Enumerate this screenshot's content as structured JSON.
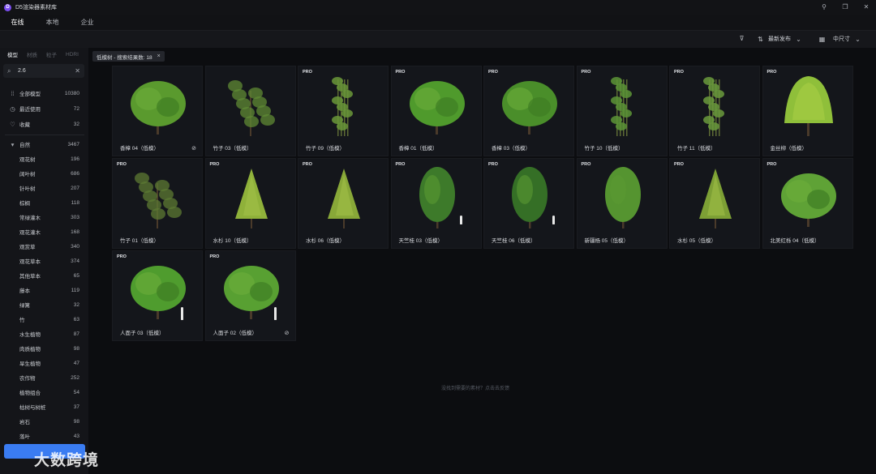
{
  "app": {
    "logo_letter": "D",
    "title": "D5渲染器素材库"
  },
  "window_buttons": [
    "pin",
    "restore",
    "close"
  ],
  "top_tabs": [
    {
      "label": "在线",
      "active": true
    },
    {
      "label": "本地",
      "active": false
    },
    {
      "label": "企业",
      "active": false
    }
  ],
  "toolbar": {
    "filter_icon": "filter-icon",
    "sort_label": "最新发布",
    "size_label": "中尺寸"
  },
  "sidebar": {
    "tabs": [
      {
        "label": "模型",
        "active": true
      },
      {
        "label": "材质",
        "active": false
      },
      {
        "label": "粒子",
        "active": false
      },
      {
        "label": "HDRI",
        "active": false
      }
    ],
    "search": {
      "value": "2.6"
    },
    "quick": [
      {
        "icon": "grid-icon",
        "label": "全部模型",
        "count": "10380"
      },
      {
        "icon": "clock-icon",
        "label": "最近使用",
        "count": "72"
      },
      {
        "icon": "heart-icon",
        "label": "收藏",
        "count": "32"
      }
    ],
    "category": {
      "label": "自然",
      "count": "3467"
    },
    "items": [
      {
        "label": "观花树",
        "count": "196"
      },
      {
        "label": "阔叶树",
        "count": "686"
      },
      {
        "label": "针叶树",
        "count": "207"
      },
      {
        "label": "棕榈",
        "count": "118"
      },
      {
        "label": "常绿灌木",
        "count": "303"
      },
      {
        "label": "观花灌木",
        "count": "168"
      },
      {
        "label": "观赏草",
        "count": "340"
      },
      {
        "label": "观花草本",
        "count": "374"
      },
      {
        "label": "其他草本",
        "count": "65"
      },
      {
        "label": "藤本",
        "count": "119"
      },
      {
        "label": "绿篱",
        "count": "32"
      },
      {
        "label": "竹",
        "count": "63"
      },
      {
        "label": "水生植物",
        "count": "87"
      },
      {
        "label": "肉质植物",
        "count": "98"
      },
      {
        "label": "旱生植物",
        "count": "47"
      },
      {
        "label": "农作物",
        "count": "252"
      },
      {
        "label": "植物组合",
        "count": "54"
      },
      {
        "label": "枯树与树桩",
        "count": "37"
      },
      {
        "label": "岩石",
        "count": "98"
      },
      {
        "label": "落叶",
        "count": "43"
      }
    ]
  },
  "chip": {
    "label": "低模树 - 搜索结果数: 18",
    "close": "×"
  },
  "cards": [
    {
      "name": "香樟 04（低模）",
      "pro": "",
      "check": true,
      "person": false,
      "shape": "round",
      "color": "#5a9a2e"
    },
    {
      "name": "竹子 03（低模）",
      "pro": "",
      "check": false,
      "person": false,
      "shape": "sparse",
      "color": "#5f8a34"
    },
    {
      "name": "竹子 09（低模）",
      "pro": "PRO",
      "check": false,
      "person": false,
      "shape": "bamboo",
      "color": "#6a9838"
    },
    {
      "name": "香樟 01（低模）",
      "pro": "PRO",
      "check": false,
      "person": false,
      "shape": "round",
      "color": "#4f9a2c"
    },
    {
      "name": "香樟 03（低模）",
      "pro": "PRO",
      "check": false,
      "person": false,
      "shape": "round",
      "color": "#4a8e2a"
    },
    {
      "name": "竹子 10（低模）",
      "pro": "PRO",
      "check": false,
      "person": false,
      "shape": "bamboo",
      "color": "#5c9436"
    },
    {
      "name": "竹子 11（低模）",
      "pro": "PRO",
      "check": false,
      "person": false,
      "shape": "bamboo",
      "color": "#6a9a3c"
    },
    {
      "name": "金丝柳（低模）",
      "pro": "PRO",
      "check": false,
      "person": false,
      "shape": "willow",
      "color": "#8fbf3a"
    },
    {
      "name": "竹子 01（低模）",
      "pro": "PRO",
      "check": false,
      "person": false,
      "shape": "sparse",
      "color": "#5c7a33"
    },
    {
      "name": "水杉 10（低模）",
      "pro": "PRO",
      "check": false,
      "person": false,
      "shape": "cone",
      "color": "#8fb13a"
    },
    {
      "name": "水杉 06（低模）",
      "pro": "PRO",
      "check": false,
      "person": false,
      "shape": "cone",
      "color": "#88a838"
    },
    {
      "name": "天竺桂 03（低模）",
      "pro": "PRO",
      "check": false,
      "person": true,
      "shape": "tall",
      "color": "#3d7a2a"
    },
    {
      "name": "天竺桂 06（低模）",
      "pro": "PRO",
      "check": false,
      "person": true,
      "shape": "tall",
      "color": "#356f26"
    },
    {
      "name": "新疆杨 05（低模）",
      "pro": "PRO",
      "check": false,
      "person": false,
      "shape": "tall",
      "color": "#559430"
    },
    {
      "name": "水杉 05（低模）",
      "pro": "PRO",
      "check": false,
      "person": false,
      "shape": "cone",
      "color": "#7da035"
    },
    {
      "name": "北美红栎 04（低模）",
      "pro": "PRO",
      "check": false,
      "person": false,
      "shape": "round",
      "color": "#5fa236"
    },
    {
      "name": "人面子 03（低模）",
      "pro": "PRO",
      "check": false,
      "person": true,
      "shape": "round",
      "color": "#4f9c2e"
    },
    {
      "name": "人面子 02（低模）",
      "pro": "PRO",
      "check": true,
      "person": true,
      "shape": "round",
      "color": "#58a032"
    }
  ],
  "empty_hint": "没找到需要的素材？点击去反馈",
  "watermark": "大数跨境"
}
